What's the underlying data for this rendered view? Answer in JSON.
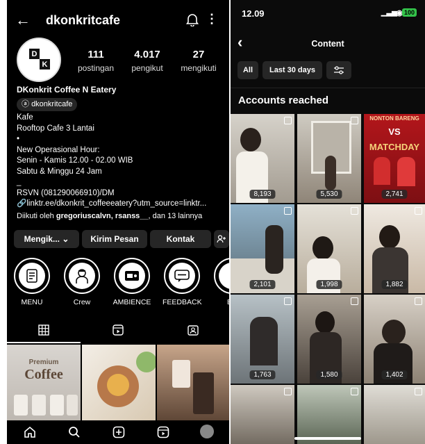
{
  "profile": {
    "username": "dkonkritcafe",
    "logo_letters": [
      "D",
      "",
      "",
      "K"
    ],
    "stats": [
      {
        "value": "111",
        "label": "postingan"
      },
      {
        "value": "4.017",
        "label": "pengikut"
      },
      {
        "value": "27",
        "label": "mengikuti"
      }
    ],
    "bio": {
      "name": "DKonkrit Coffee N Eatery",
      "threads_handle": "dkonkritcafe",
      "lines": [
        "Kafe",
        "Rooftop Cafe 3 Lantai",
        "•",
        "New Operasional Hour:",
        "Senin - Kamis 12.00 - 02.00 WIB",
        "Sabtu & Minggu 24 Jam",
        "_",
        "RSVN (081290066910)/DM"
      ],
      "link": "linktr.ee/dkonkrit_coffeeeatery?utm_source=linktr...",
      "followed_by_prefix": "Diikuti oleh ",
      "followed_by_names": "gregoriuscalvn, rsanss__",
      "followed_by_suffix": ", dan 13 lainnya"
    },
    "buttons": {
      "following": "Mengik...",
      "message": "Kirim Pesan",
      "contact": "Kontak"
    },
    "highlights": [
      "MENU",
      "Crew",
      "AMBIENCE",
      "FEEDBACK",
      "EV"
    ],
    "post_thumb_text": [
      "Premium",
      "Coffee"
    ]
  },
  "insights": {
    "time": "12.09",
    "battery": "100",
    "title": "Content",
    "filters": [
      "All",
      "Last 30 days"
    ],
    "section_title": "Accounts reached",
    "banner_text": [
      "NONTON BARENG",
      "VS",
      "MATCHDAY"
    ],
    "counts": [
      "8,193",
      "5,530",
      "2,741",
      "2,101",
      "1,998",
      "1,882",
      "1,763",
      "1,580",
      "1,402"
    ]
  }
}
